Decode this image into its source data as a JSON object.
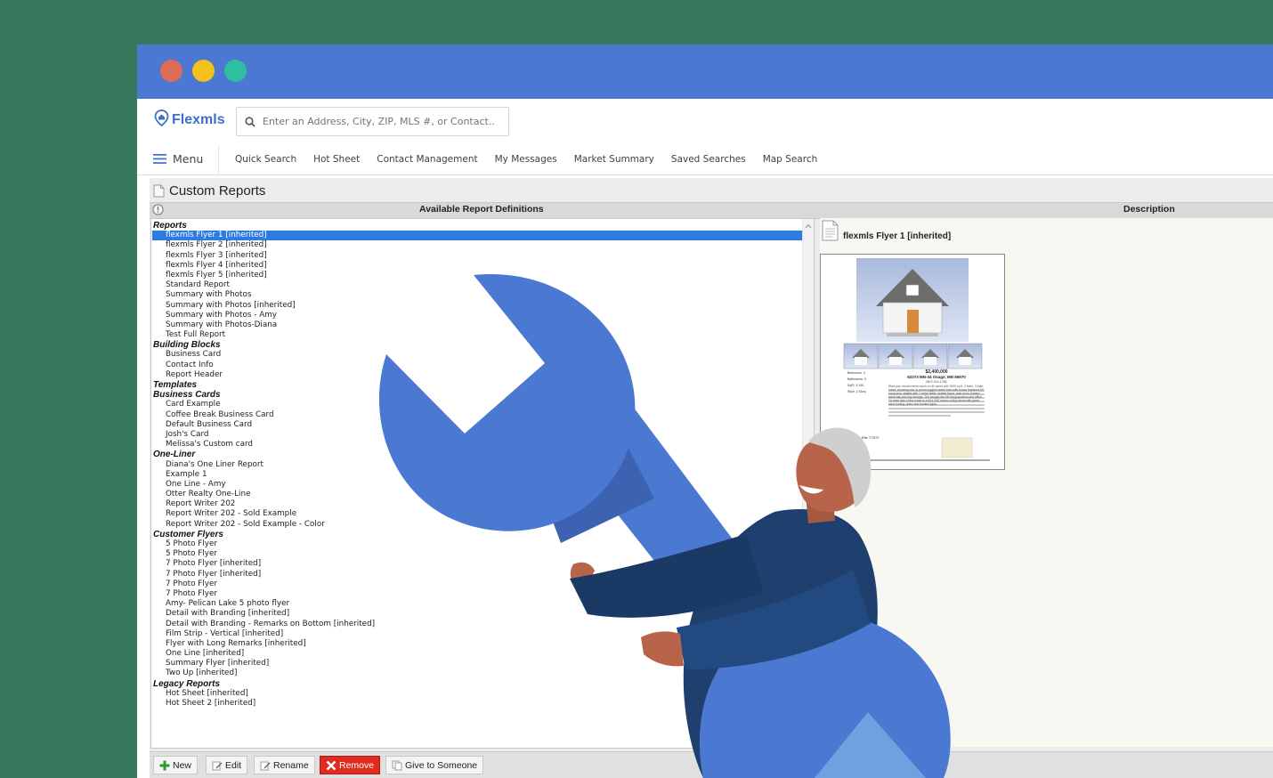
{
  "window": {
    "traffic_lights": {
      "close_color": "#de6b56",
      "minimize_color": "#f3c21a",
      "zoom_color": "#2fbfa0"
    },
    "titlebar_color": "#4b78d0"
  },
  "header": {
    "logo_text": "Flexmls",
    "search_placeholder": "Enter an Address, City, ZIP, MLS #, or Contact..."
  },
  "nav": {
    "menu_label": "Menu",
    "links": [
      "Quick Search",
      "Hot Sheet",
      "Contact Management",
      "My Messages",
      "Market Summary",
      "Saved Searches",
      "Map Search"
    ]
  },
  "page": {
    "title": "Custom Reports",
    "list_header": "Available Report Definitions",
    "description_header": "Description"
  },
  "report_groups": [
    {
      "name": "Reports",
      "items": [
        "flexmls Flyer 1 [inherited]",
        "flexmls Flyer 2 [inherited]",
        "flexmls Flyer 3 [inherited]",
        "flexmls Flyer 4 [inherited]",
        "flexmls Flyer 5 [inherited]",
        "Standard Report",
        "Summary with Photos",
        "Summary with Photos [inherited]",
        "Summary with Photos - Amy",
        "Summary with Photos-Diana",
        "Test Full Report"
      ]
    },
    {
      "name": "Building Blocks",
      "items": [
        "Business Card",
        "Contact Info",
        "Report Header"
      ]
    },
    {
      "name": "Templates",
      "items": []
    },
    {
      "name": "Business Cards",
      "items": [
        "Card Example",
        "Coffee Break Business Card",
        "Default Business Card",
        "Josh's Card",
        "Melissa's Custom card"
      ]
    },
    {
      "name": "One-Liner",
      "items": [
        "Diana's One Liner Report",
        "Example 1",
        "One Line - Amy",
        "Otter Realty One-Line",
        "Report Writer 202",
        "Report Writer 202 - Sold Example",
        "Report Writer 202 - Sold Example - Color"
      ]
    },
    {
      "name": "Customer Flyers",
      "items": [
        "5 Photo Flyer",
        "5 Photo Flyer",
        "7 Photo Flyer [inherited]",
        "7 Photo Flyer [inherited]",
        "7 Photo Flyer",
        "7 Photo Flyer",
        "Amy- Pelican Lake 5 photo flyer",
        "Detail with Branding [inherited]",
        "Detail with Branding - Remarks on Bottom [inherited]",
        "Film Strip - Vertical [inherited]",
        "Flyer with Long Remarks [inherited]",
        "One Line [inherited]",
        "Summary Flyer [inherited]",
        "Two Up [inherited]"
      ]
    },
    {
      "name": "Legacy Reports",
      "items": [
        "Hot Sheet [inherited]",
        "Hot Sheet 2 [inherited]"
      ]
    }
  ],
  "selected_item": "flexmls Flyer 1 [inherited]",
  "description": {
    "title": "flexmls Flyer 1 [inherited]",
    "preview": {
      "price": "$2,400,000",
      "address": "62273 MN-34 Osage, MN 56570",
      "mls": "MLS 414-1746",
      "facts": [
        "Bedrooms: 3",
        "Bathrooms: 3",
        "SqFt: 3,100",
        "Style: 2 Story"
      ],
      "remarks": "Start your dream home ranch on 60 acres with 3000 sq ft, 3 bdrm, 3 bath home. Amazing one of a kind rugged roofed barn with indoor timbered 60' round pen, stalled with 7 horse stalls, heated floors, tack room, heated wash bay and hay storage. The lounge has full living quarters and office. On west side of the home is a 60'x 200' indoor rolling arena with great sand footing, water and heated lights.",
      "footer": "Listed Presentation of: Elite 777879"
    }
  },
  "toolbar": {
    "new_label": "New",
    "edit_label": "Edit",
    "rename_label": "Rename",
    "remove_label": "Remove",
    "give_label": "Give to Someone"
  },
  "illustration": {
    "wrench_color": "#4b78d0",
    "skin_color": "#b8644a",
    "shirt_color": "#1f406f",
    "hair_color": "#cfcfcf"
  }
}
